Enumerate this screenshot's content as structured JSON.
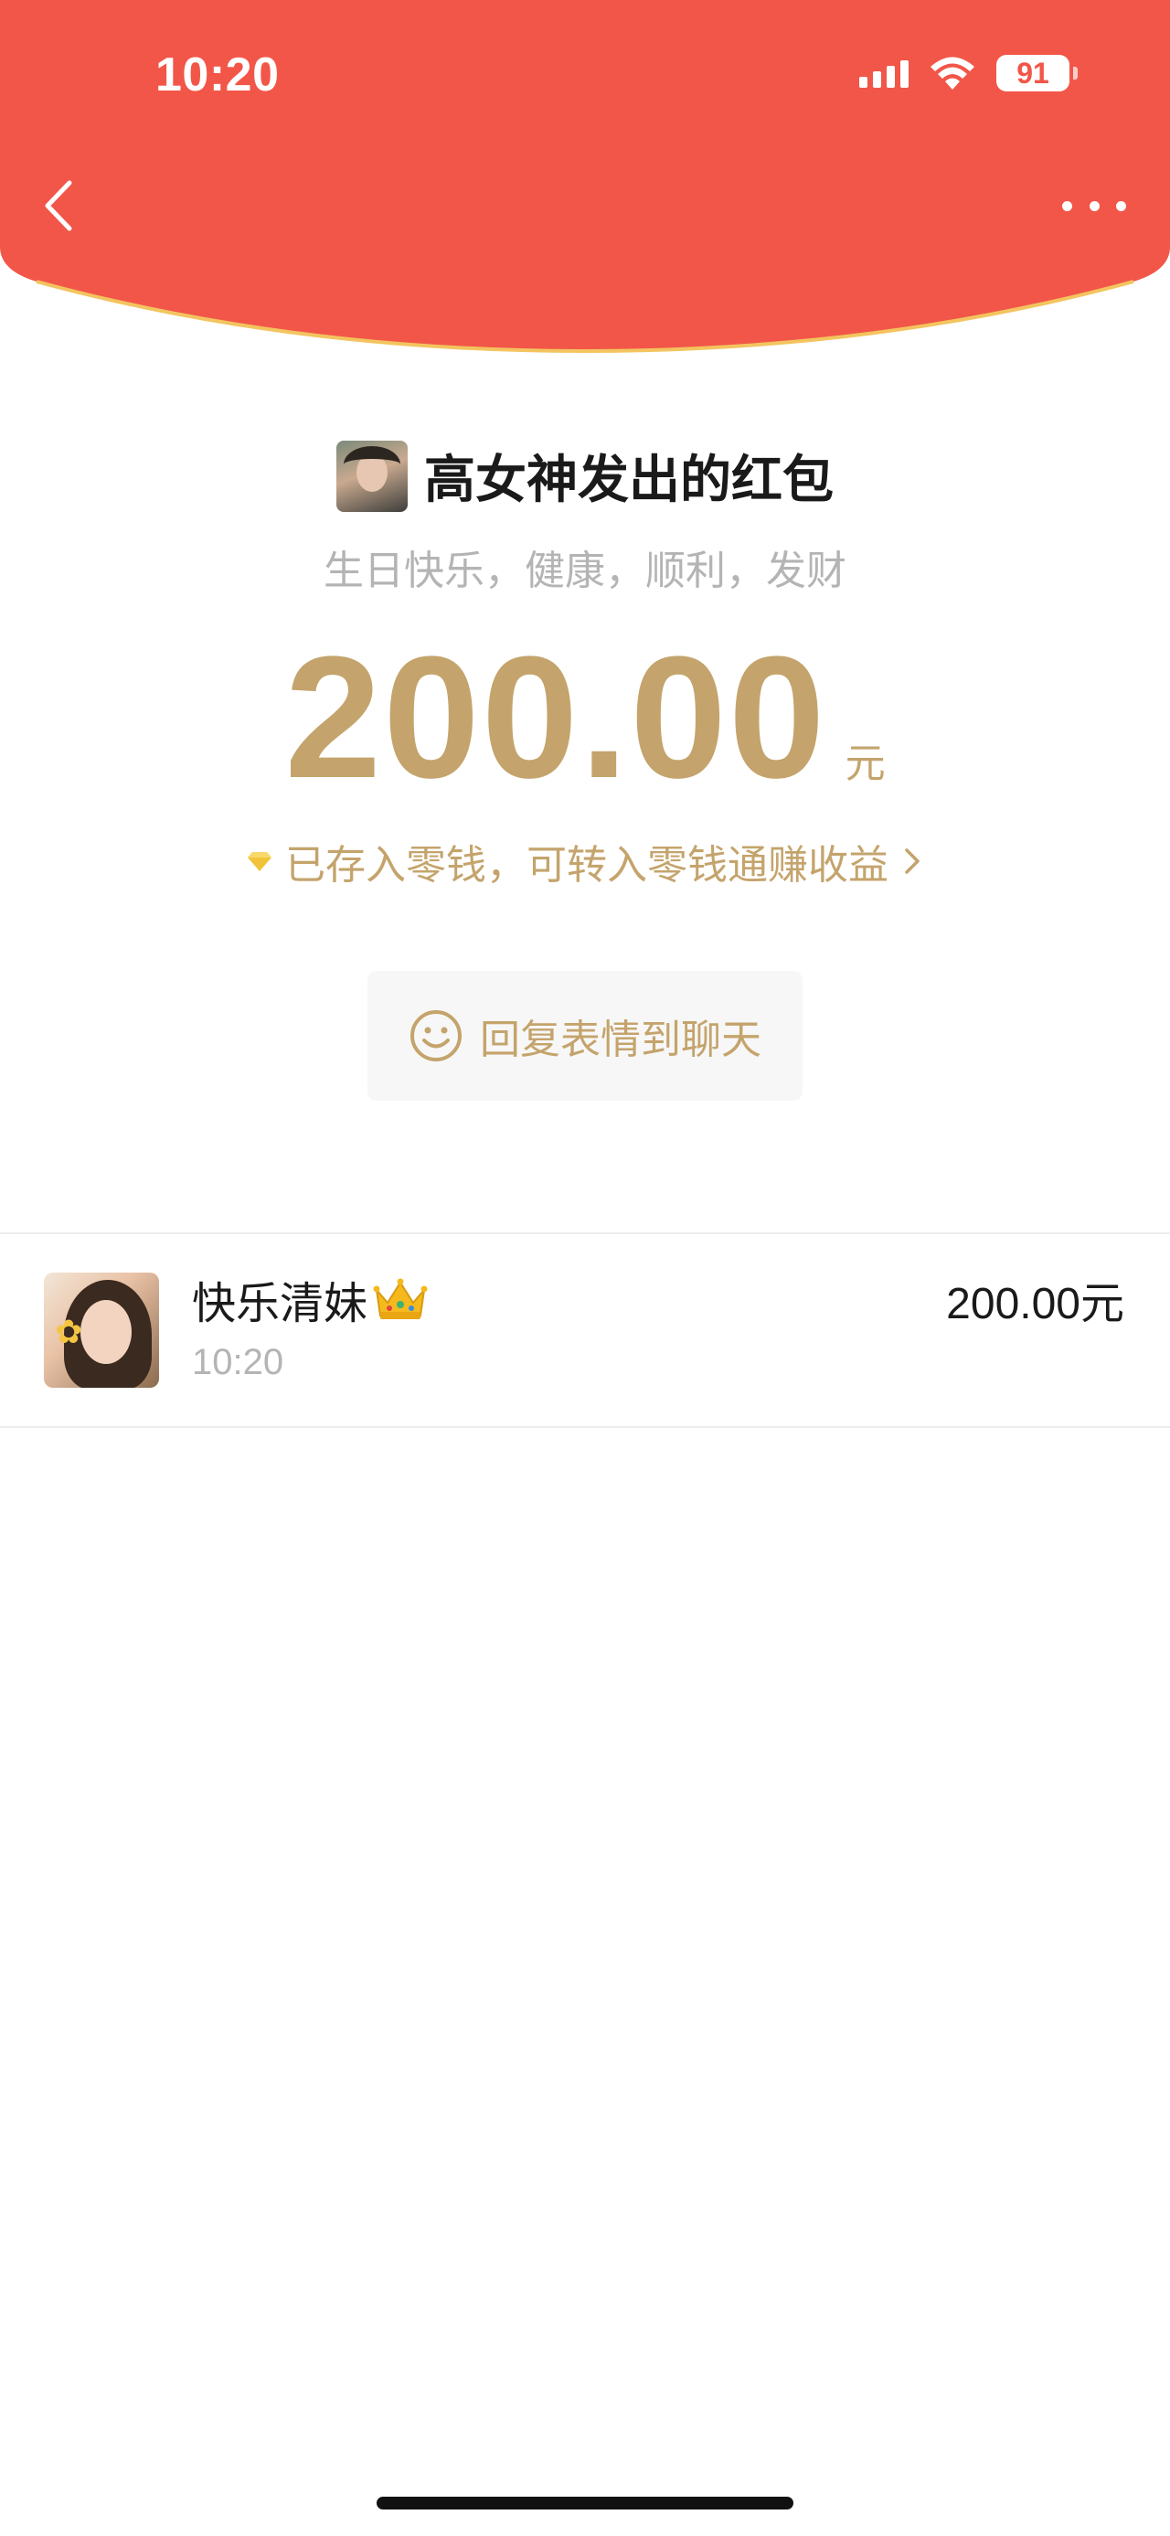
{
  "status_bar": {
    "time": "10:20",
    "battery_level": "91",
    "signal_icon": "cellular-signal-icon",
    "wifi_icon": "wifi-icon"
  },
  "header": {
    "background_color": "#f25648",
    "back_icon": "chevron-left-icon",
    "more_icon": "more-horizontal-icon"
  },
  "packet": {
    "sender_title": "高女神发出的红包",
    "blessing": "生日快乐，健康，顺利，发财",
    "amount": "200.00",
    "unit": "元",
    "deposit_link": "已存入零钱，可转入零钱通赚收益",
    "reply_button": "回复表情到聊天",
    "accent_color": "#c4a46c"
  },
  "receivers": [
    {
      "name": "快乐清妹",
      "badge_icon": "crown-icon",
      "time": "10:20",
      "amount": "200.00元"
    }
  ]
}
